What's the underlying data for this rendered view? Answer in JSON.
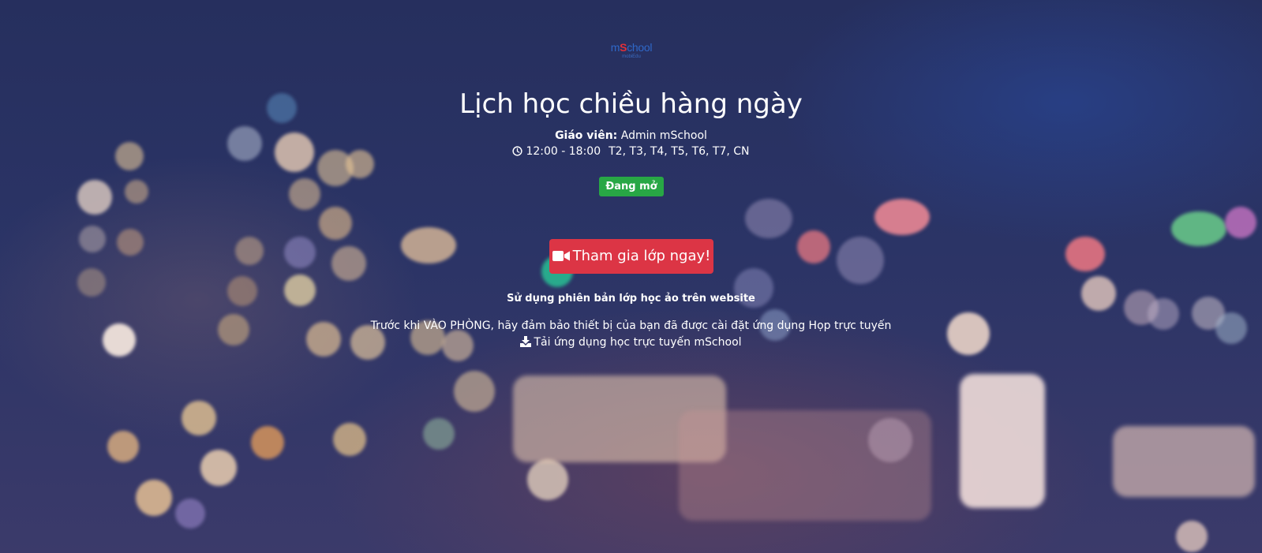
{
  "logo": {
    "brand_prefix": "m",
    "brand_s": "S",
    "brand_suffix": "chool",
    "sub": "mobiEdu"
  },
  "class": {
    "title": "Lịch học chiều hàng ngày",
    "teacher_label": "Giáo viên:",
    "teacher_name": "Admin mSchool",
    "time": "12:00 - 18:00",
    "days": "T2, T3, T4, T5, T6, T7, CN",
    "status": "Đang mở"
  },
  "actions": {
    "join_label": "Tham gia lớp ngay!",
    "web_version_label": "Sử dụng phiên bản lớp học ảo trên website",
    "notice": "Trước khi VÀO PHÒNG, hãy đảm bảo thiết bị của bạn đã được cài đặt ứng dụng Họp trực tuyến",
    "download_label": "Tải ứng dụng học trực tuyến mSchool"
  },
  "icons": {
    "clock": "clock-icon",
    "join": "video-camera-icon",
    "download": "download-icon"
  },
  "colors": {
    "status_badge": "#28a745",
    "join_button": "#dc3545",
    "background": "#2a3262",
    "logo_blue": "#2f68c8",
    "logo_red": "#e0303a"
  }
}
